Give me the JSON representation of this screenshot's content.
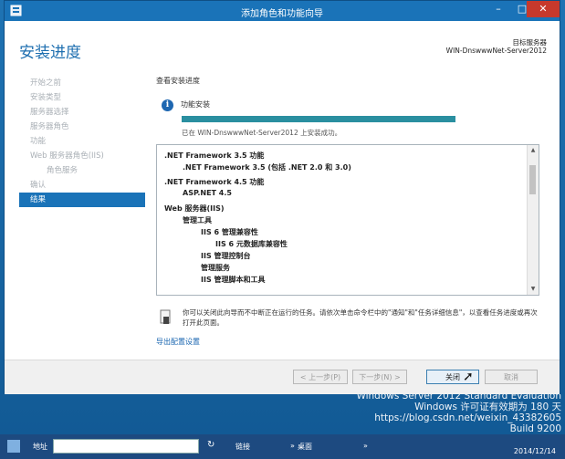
{
  "window": {
    "title": "添加角色和功能向导"
  },
  "header": {
    "title": "安装进度",
    "destination_label": "目标服务器",
    "destination_value": "WIN-DnswwwNet-Server2012"
  },
  "nav": {
    "items": [
      {
        "label": "开始之前",
        "state": "disabled"
      },
      {
        "label": "安装类型",
        "state": "disabled"
      },
      {
        "label": "服务器选择",
        "state": "disabled"
      },
      {
        "label": "服务器角色",
        "state": "disabled"
      },
      {
        "label": "功能",
        "state": "disabled"
      },
      {
        "label": "Web 服务器角色(IIS)",
        "state": "disabled"
      },
      {
        "label": "角色服务",
        "state": "disabled"
      },
      {
        "label": "确认",
        "state": "disabled"
      },
      {
        "label": "结果",
        "state": "active"
      }
    ]
  },
  "content": {
    "section_label": "查看安装进度",
    "feature_install": "功能安装",
    "progress": 1.0,
    "status": "已在 WIN-DnswwwNet-Server2012 上安装成功。",
    "list": [
      {
        "text": ".NET Framework 3.5 功能",
        "level": 0
      },
      {
        "text": ".NET Framework 3.5 (包括 .NET 2.0 和 3.0)",
        "level": 1
      },
      {
        "text": ".NET Framework 4.5 功能",
        "level": 0
      },
      {
        "text": "ASP.NET 4.5",
        "level": 1
      },
      {
        "text": "Web 服务器(IIS)",
        "level": 0
      },
      {
        "text": "管理工具",
        "level": 1
      },
      {
        "text": "IIS 6 管理兼容性",
        "level": 2
      },
      {
        "text": "IIS 6 元数据库兼容性",
        "level": 3
      },
      {
        "text": "IIS 管理控制台",
        "level": 2
      },
      {
        "text": "管理服务",
        "level": 2
      },
      {
        "text": "IIS 管理脚本和工具",
        "level": 2
      }
    ],
    "note": "你可以关闭此向导而不中断正在运行的任务。请依次单击命令栏中的\"通知\"和\"任务详细信息\"，以查看任务进度或再次打开此页面。",
    "export_link": "导出配置设置"
  },
  "buttons": {
    "prev": "< 上一步(P)",
    "next": "下一步(N) >",
    "close": "关闭",
    "cancel": "取消"
  },
  "desktop_watermark": {
    "line1": "Windows Server 2012 Standard Evaluation",
    "line2": "Windows 许可证有效期为 180 天",
    "line3": "https://blog.csdn.net/weixin_43382605",
    "line4": "Build 9200"
  },
  "taskbar": {
    "address_label": "地址",
    "links_label": "链接",
    "desktop_label": "桌面",
    "date": "2014/12/14"
  },
  "colors": {
    "accent": "#1a73b8",
    "progress_fill": "#2a8fa0",
    "close_button": "#c7392c",
    "taskbar": "#1d4a80"
  }
}
